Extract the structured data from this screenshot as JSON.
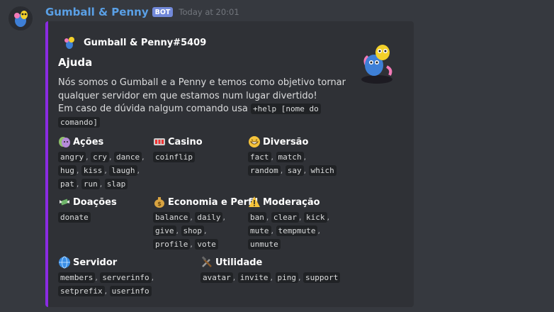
{
  "message": {
    "username": "Gumball & Penny",
    "bot_tag": "BOT",
    "timestamp": "Today at 20:01"
  },
  "embed": {
    "accent_color": "#8a2be2",
    "author": "Gumball & Penny#5409",
    "title": "Ajuda",
    "description_lines": [
      "Nós somos o Gumball e a Penny e temos como objetivo tornar",
      "qualquer servidor em que estamos num lugar divertido!",
      "Em caso de dúvida nalgum comando usa"
    ],
    "help_command_part1": "+help [nome do",
    "help_command_part2": "comando]",
    "fields": {
      "acoes": {
        "emoji": "masks-icon",
        "title": "Ações",
        "lines": [
          [
            "angry",
            "cry",
            "dance"
          ],
          [
            "hug",
            "kiss",
            "laugh"
          ],
          [
            "pat",
            "run",
            "slap"
          ]
        ]
      },
      "casino": {
        "emoji": "slot-machine-icon",
        "title": "Casino",
        "lines": [
          [
            "coinflip"
          ]
        ]
      },
      "diversao": {
        "emoji": "grin-icon",
        "title": "Diversão",
        "lines": [
          [
            "fact",
            "match"
          ],
          [
            "random",
            "say",
            "which"
          ]
        ]
      },
      "doacoes": {
        "emoji": "money-wings-icon",
        "title": "Doações",
        "lines": [
          [
            "donate"
          ]
        ]
      },
      "economia": {
        "emoji": "money-bag-icon",
        "title": "Economia e Perfil",
        "lines": [
          [
            "balance",
            "daily"
          ],
          [
            "give",
            "shop"
          ],
          [
            "profile",
            "vote"
          ]
        ]
      },
      "moderacao": {
        "emoji": "warning-icon",
        "title": "Moderação",
        "lines": [
          [
            "ban",
            "clear",
            "kick"
          ],
          [
            "mute",
            "tempmute"
          ],
          [
            "unmute"
          ]
        ]
      },
      "servidor": {
        "emoji": "globe-icon",
        "title": "Servidor",
        "lines": [
          [
            "members",
            "serverinfo"
          ],
          [
            "setprefix",
            "userinfo"
          ]
        ]
      },
      "utilidade": {
        "emoji": "hammer-wrench-icon",
        "title": "Utilidade",
        "lines": [
          [
            "avatar",
            "invite",
            "ping",
            "support"
          ]
        ]
      }
    }
  }
}
